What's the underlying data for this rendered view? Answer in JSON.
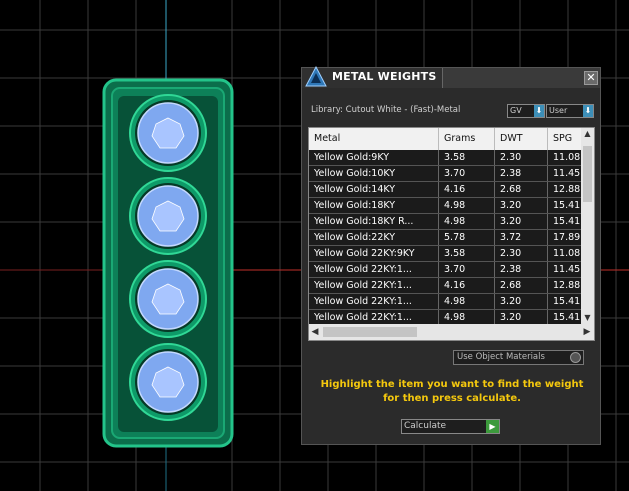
{
  "panel": {
    "title": "METAL WEIGHTS",
    "close_glyph": "✕",
    "library_label": "Library: Cutout White - (Fast)-Metal",
    "gv_label": "GV",
    "user_label": "User",
    "toggle_glyph": "⬇",
    "table": {
      "columns": [
        "Metal",
        "Grams",
        "DWT",
        "SPG"
      ],
      "rows": [
        [
          "Yellow Gold:9KY",
          "3.58",
          "2.30",
          "11.08"
        ],
        [
          "Yellow Gold:10KY",
          "3.70",
          "2.38",
          "11.45"
        ],
        [
          "Yellow Gold:14KY",
          "4.16",
          "2.68",
          "12.88"
        ],
        [
          "Yellow Gold:18KY",
          "4.98",
          "3.20",
          "15.41"
        ],
        [
          "Yellow Gold:18KY R...",
          "4.98",
          "3.20",
          "15.41"
        ],
        [
          "Yellow Gold:22KY",
          "5.78",
          "3.72",
          "17.89"
        ],
        [
          "Yellow Gold 22KY:9KY",
          "3.58",
          "2.30",
          "11.08"
        ],
        [
          "Yellow Gold 22KY:1...",
          "3.70",
          "2.38",
          "11.45"
        ],
        [
          "Yellow Gold 22KY:1...",
          "4.16",
          "2.68",
          "12.88"
        ],
        [
          "Yellow Gold 22KY:1...",
          "4.98",
          "3.20",
          "15.41"
        ],
        [
          "Yellow Gold 22KY:1...",
          "4.98",
          "3.20",
          "15.41"
        ]
      ]
    },
    "use_object_materials": "Use Object Materials",
    "hint": "Highlight the item you want to find the weight for then press calculate.",
    "calculate_label": "Calculate",
    "calculate_glyph": "▶"
  },
  "colors": {
    "hint": "#f4c80e",
    "ring_green": "#0f9a6a",
    "gem_blue": "#7fa8f0",
    "axis_red": "#c0302a",
    "axis_cyan": "#3aa9c9"
  },
  "icons": [
    "app-logo-icon",
    "close-icon",
    "gv-dropdown-icon",
    "user-dropdown-icon",
    "scroll-up-icon",
    "scroll-down-icon",
    "scroll-left-icon",
    "scroll-right-icon",
    "radio-icon",
    "play-icon"
  ]
}
